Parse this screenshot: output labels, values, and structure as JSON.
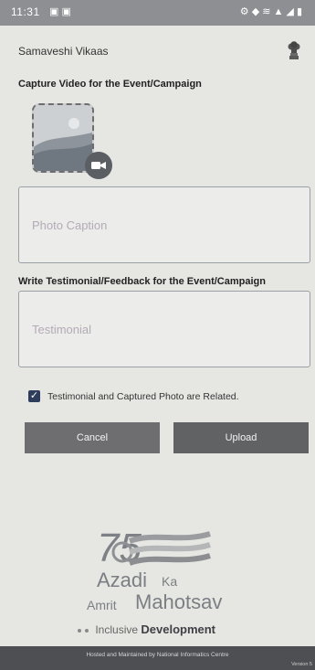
{
  "status_bar": {
    "time": "11:31",
    "left_icons": "▣ ▣",
    "right_icons": "⚙ ◆ ≋ ▲ ◢ ▮"
  },
  "app_bar": {
    "title": "Samaveshi Vikaas",
    "emblem_icon": "national-emblem-icon"
  },
  "video_section": {
    "title": "Capture Video for the Event/Campaign",
    "camera_icon": "video-camera-icon"
  },
  "photo_caption": {
    "placeholder": "Photo Caption",
    "value": ""
  },
  "testimonial_section": {
    "title": "Write Testimonial/Feedback for the Event/Campaign"
  },
  "testimonial": {
    "placeholder": "Testimonial",
    "value": ""
  },
  "related_checkbox": {
    "label": "Testimonial and Captured Photo are Related.",
    "checked": true
  },
  "buttons": {
    "cancel": "Cancel",
    "upload": "Upload"
  },
  "logo": {
    "line1": "Azadi",
    "line1_ka": "Ka",
    "line2a": "Amrit",
    "line2b": "Mahotsav"
  },
  "tagline": {
    "part1": "Inclusive",
    "part2": "Development"
  },
  "footer": {
    "hosted": "Hosted and Maintained by National Informatics Centre",
    "version": "Version 5"
  },
  "colors": {
    "button_bg": "#666769",
    "checkbox": "#2f3d5c",
    "footer_bg": "#4d4f52"
  }
}
